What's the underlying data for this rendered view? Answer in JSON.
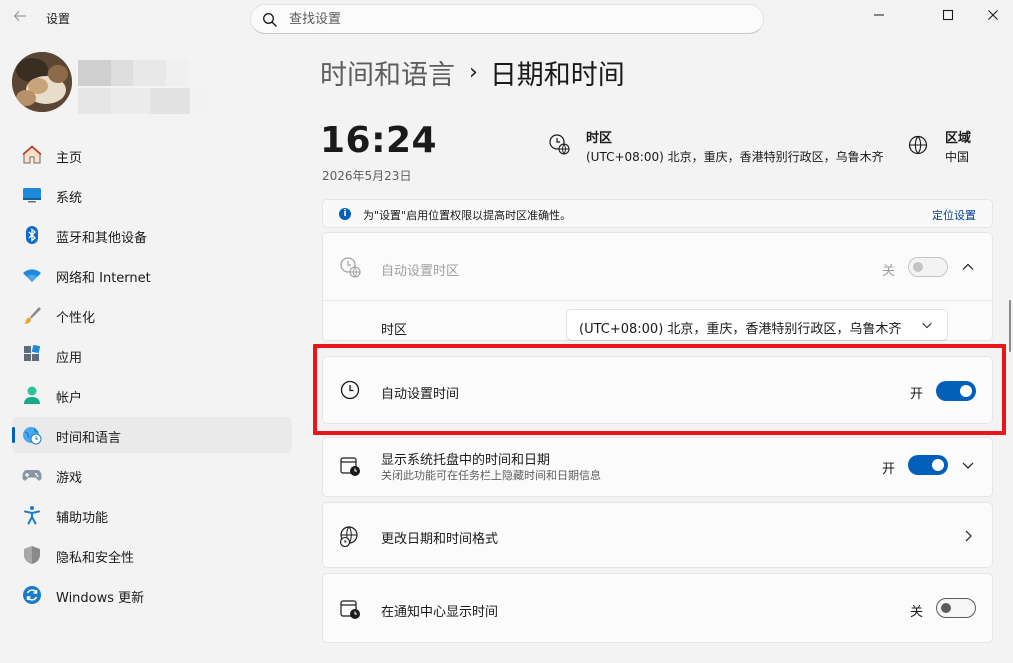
{
  "window": {
    "app_title": "设置",
    "back_icon": "arrow-left-icon",
    "controls": [
      "minimize-icon",
      "maximize-icon",
      "close-icon"
    ]
  },
  "search": {
    "placeholder": "查找设置",
    "icon": "search-icon"
  },
  "sidebar": {
    "items": [
      {
        "label": "主页",
        "icon": "home-icon"
      },
      {
        "label": "系统",
        "icon": "monitor-icon"
      },
      {
        "label": "蓝牙和其他设备",
        "icon": "bluetooth-icon"
      },
      {
        "label": "网络和 Internet",
        "icon": "wifi-icon"
      },
      {
        "label": "个性化",
        "icon": "brush-icon"
      },
      {
        "label": "应用",
        "icon": "apps-icon"
      },
      {
        "label": "帐户",
        "icon": "person-icon"
      },
      {
        "label": "时间和语言",
        "icon": "globe-clock-icon",
        "selected": true
      },
      {
        "label": "游戏",
        "icon": "gamepad-icon"
      },
      {
        "label": "辅助功能",
        "icon": "accessibility-icon"
      },
      {
        "label": "隐私和安全性",
        "icon": "shield-icon"
      },
      {
        "label": "Windows 更新",
        "icon": "refresh-icon"
      }
    ]
  },
  "header": {
    "parent": "时间和语言",
    "separator": "›",
    "current": "日期和时间"
  },
  "summary": {
    "time": "16:24",
    "date": "2026年5月23日",
    "timezone_title": "时区",
    "timezone_value": "(UTC+08:00) 北京，重庆，香港特别行政区，乌鲁木齐",
    "region_title": "区域",
    "region_value": "中国"
  },
  "infobar": {
    "text": "为\"设置\"启用位置权限以提高时区准确性。",
    "link": "定位设置"
  },
  "settings": {
    "auto_timezone": {
      "label": "自动设置时区",
      "state": "关",
      "on": false,
      "disabled": true
    },
    "timezone": {
      "label": "时区",
      "value": "(UTC+08:00) 北京，重庆，香港特别行政区，乌鲁木齐"
    },
    "auto_time": {
      "label": "自动设置时间",
      "state": "开",
      "on": true
    },
    "tray": {
      "label": "显示系统托盘中的时间和日期",
      "sub": "关闭此功能可在任务栏上隐藏时间和日期信息",
      "state": "开",
      "on": true
    },
    "format": {
      "label": "更改日期和时间格式"
    },
    "notify": {
      "label": "在通知中心显示时间",
      "state": "关",
      "on": false
    }
  },
  "colors": {
    "accent": "#005fb8",
    "highlight": "#e8161a",
    "background": "#f3f3f3"
  }
}
